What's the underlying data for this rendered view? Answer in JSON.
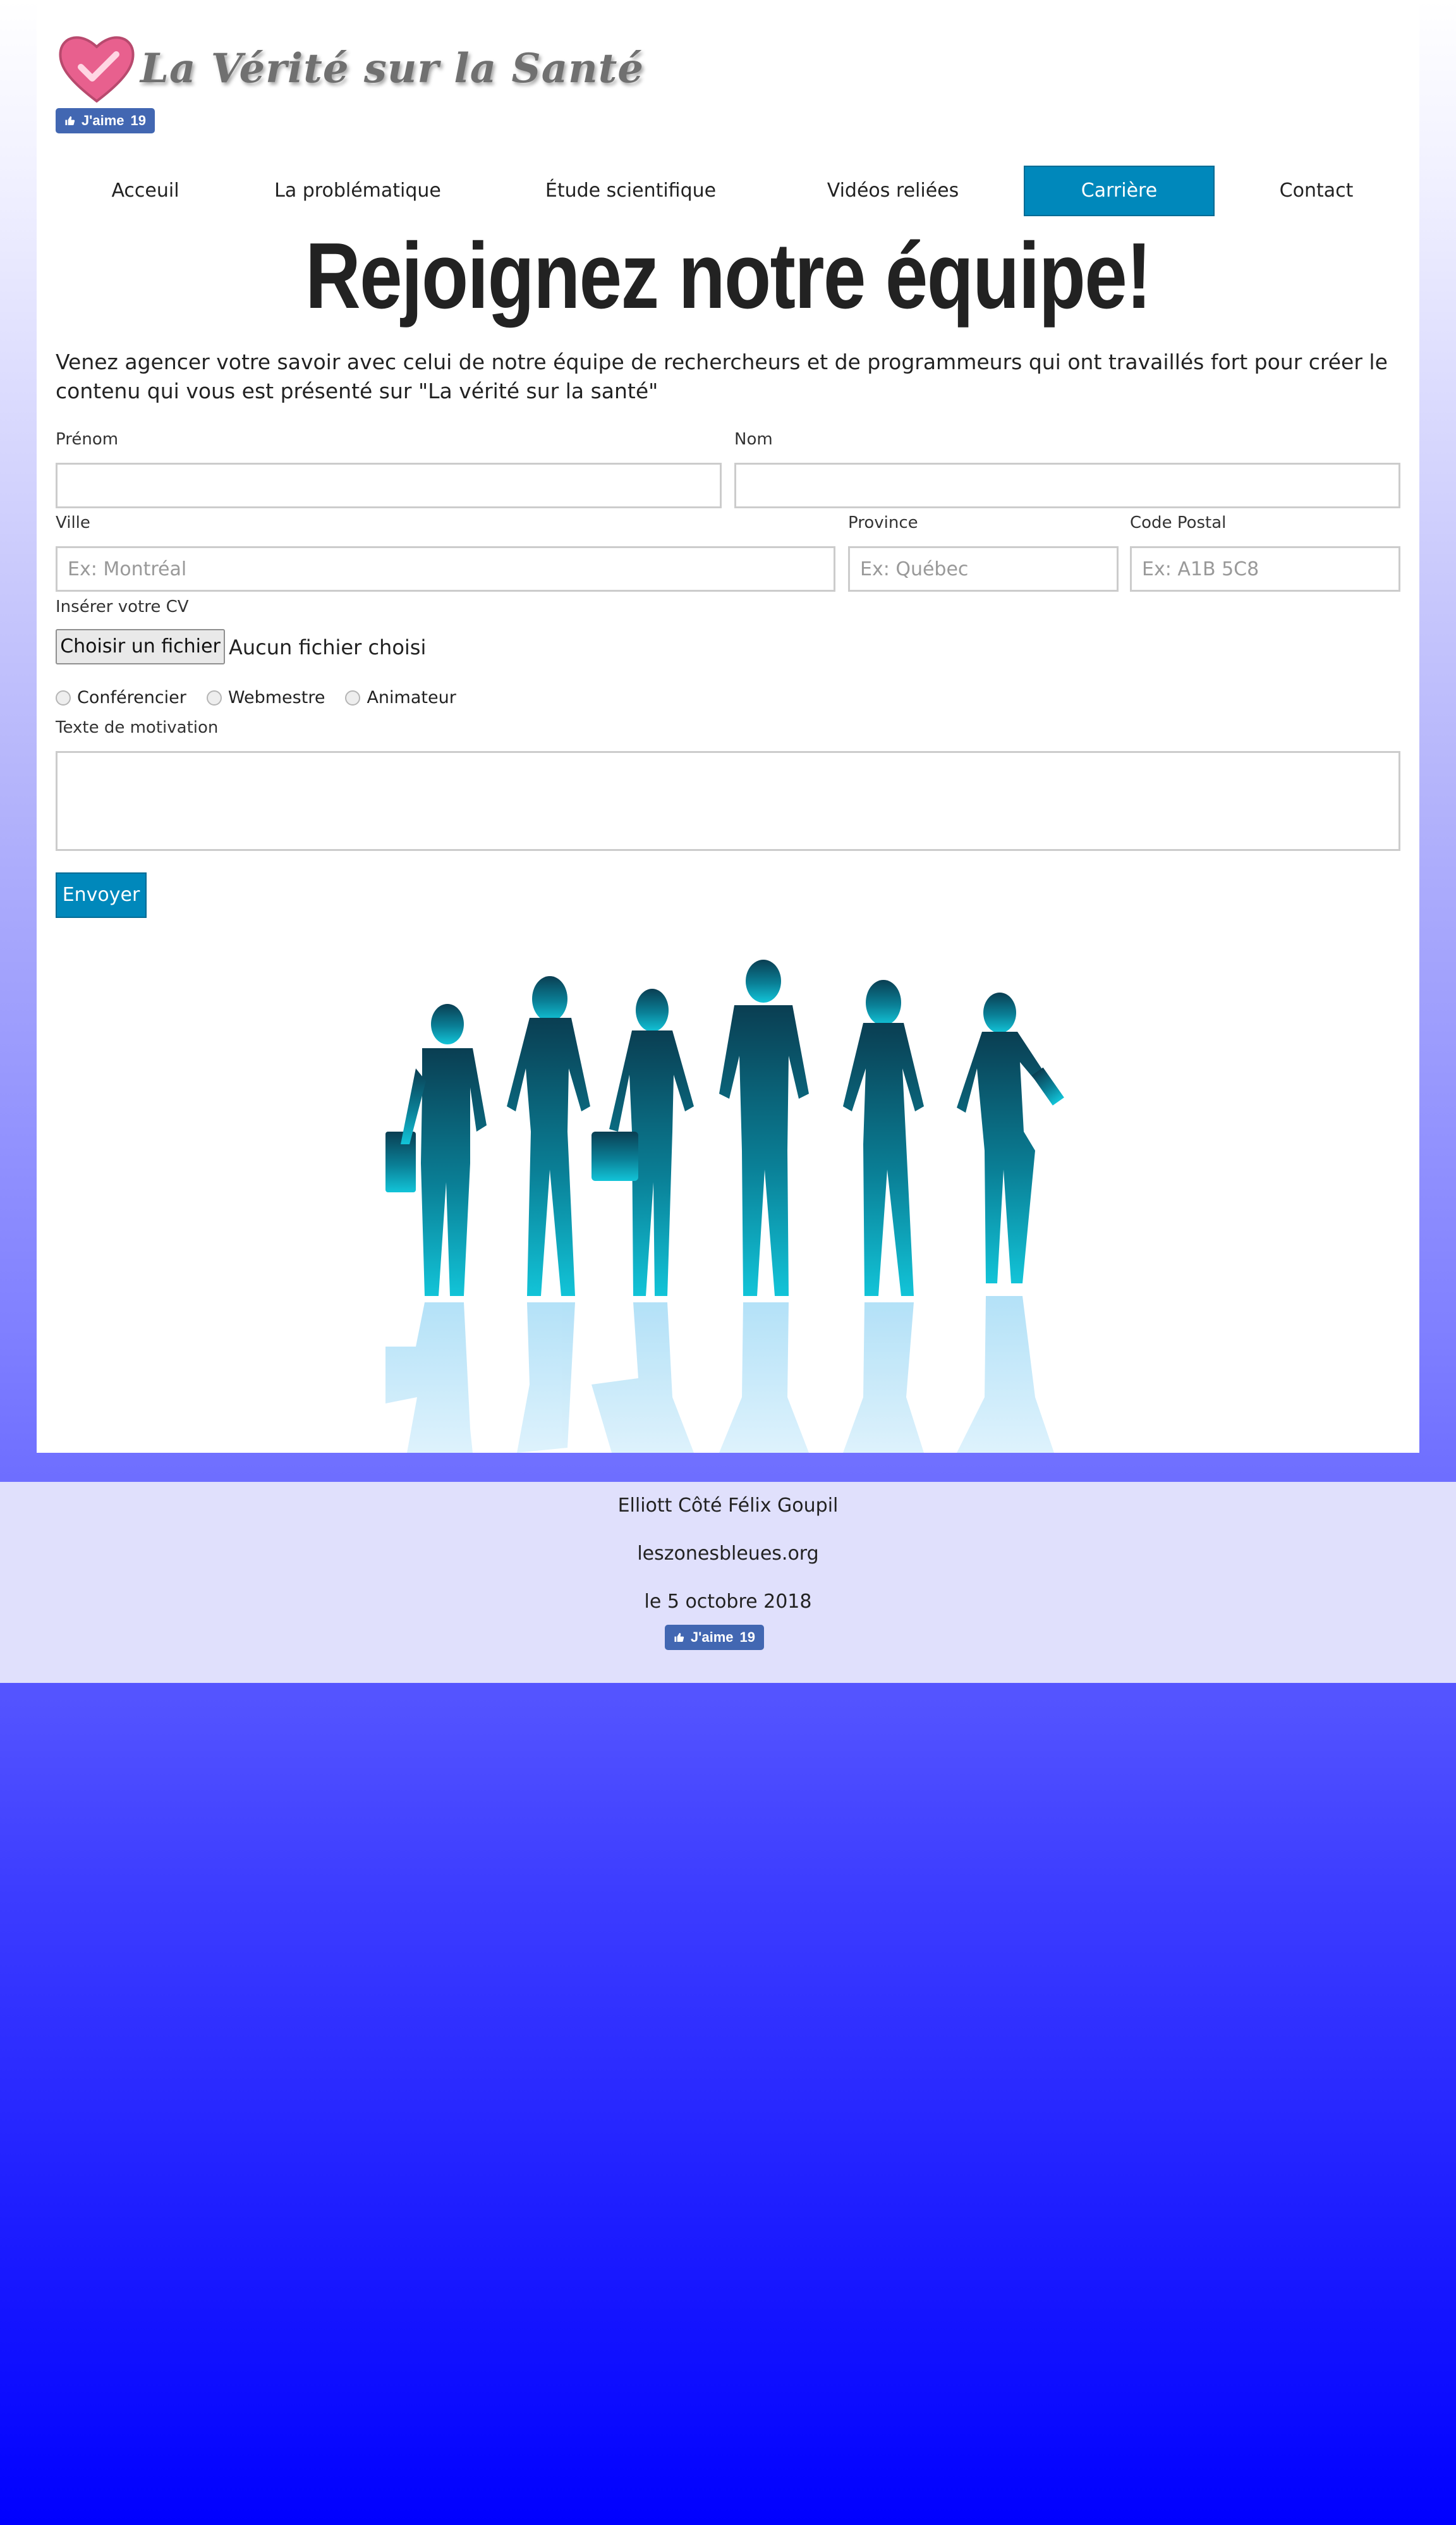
{
  "header": {
    "site_title": "La Vérité sur la Santé",
    "like_label": "J'aime",
    "like_count": "19"
  },
  "nav": {
    "items": [
      "Acceuil",
      "La problématique",
      "Étude scientifique",
      "Vidéos reliées",
      "Carrière",
      "Contact"
    ],
    "active_index": 4
  },
  "main": {
    "headline": "Rejoignez notre équipe!",
    "intro": "Venez agencer votre savoir avec celui de notre équipe de rechercheurs et de programmeurs qui ont travaillés fort pour créer le contenu qui vous est présenté sur \"La vérité sur la santé\""
  },
  "form": {
    "prenom_label": "Prénom",
    "nom_label": "Nom",
    "ville_label": "Ville",
    "ville_placeholder": "Ex: Montréal",
    "province_label": "Province",
    "province_placeholder": "Ex: Québec",
    "code_label": "Code Postal",
    "code_placeholder": "Ex: A1B 5C8",
    "cv_label": "Insérer votre CV",
    "file_button": "Choisir un fichier",
    "file_status": "Aucun fichier choisi",
    "roles": [
      "Conférencier",
      "Webmestre",
      "Animateur"
    ],
    "motivation_label": "Texte de motivation",
    "submit": "Envoyer"
  },
  "footer": {
    "authors": "Elliott Côté Félix Goupil",
    "site": "leszonesbleues.org",
    "date": "le 5 octobre 2018"
  },
  "colors": {
    "accent": "#0088bb",
    "facebook": "#4267b2",
    "footer_bg": "#e0e0fc"
  }
}
